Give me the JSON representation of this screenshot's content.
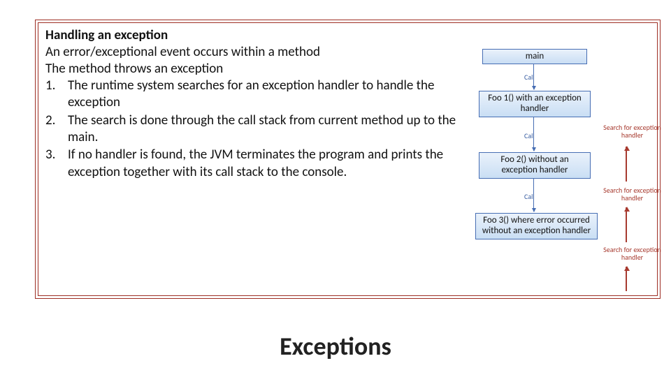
{
  "box": {
    "heading": "Handling an exception",
    "line1": "An error/exceptional event occurs within a method",
    "line2": "The method throws an exception",
    "items": [
      {
        "n": "1.",
        "t": "The runtime system searches for an exception handler to handle the exception"
      },
      {
        "n": "2.",
        "t": "The search is done through the call stack from current method up to the main."
      },
      {
        "n": "3.",
        "t": "If no handler is found, the JVM terminates the program and prints the exception together with its call stack to the console."
      }
    ]
  },
  "diagram": {
    "main": "main",
    "foo1": "Foo 1() with an exception handler",
    "foo2": "Foo 2() without an exception handler",
    "foo3": "Foo 3() where error occurred without an exception handler",
    "call": "Call",
    "search": "Search for exception handler"
  },
  "title": "Exceptions"
}
